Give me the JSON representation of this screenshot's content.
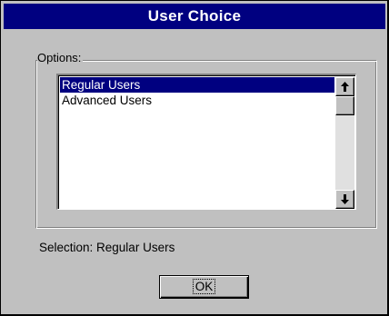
{
  "window": {
    "title": "User Choice"
  },
  "options_group": {
    "legend": "Options:"
  },
  "listbox": {
    "items": [
      {
        "label": "Regular Users",
        "selected": true
      },
      {
        "label": "Advanced Users",
        "selected": false
      }
    ],
    "scroll_up_icon": "arrow-up-icon",
    "scroll_down_icon": "arrow-down-icon"
  },
  "status": {
    "text": "Selection: Regular Users"
  },
  "buttons": {
    "ok_label": "OK"
  },
  "colors": {
    "title_bar": "#000080",
    "face": "#c0c0c0",
    "selection": "#000080"
  }
}
